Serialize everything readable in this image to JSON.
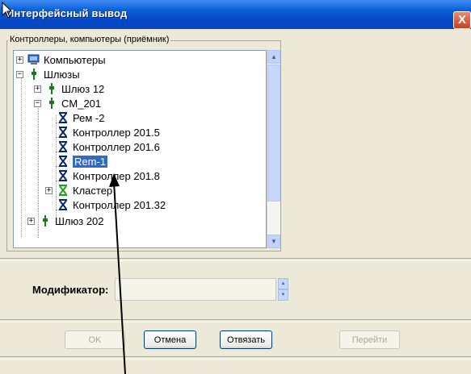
{
  "window": {
    "title": "Интерфейсный вывод",
    "close_glyph": "X"
  },
  "group": {
    "label": "Контроллеры, компьютеры (приёмник)"
  },
  "tree": {
    "items": [
      {
        "label": "Компьютеры",
        "icon": "computer-icon",
        "expander": "+"
      },
      {
        "label": "Шлюзы",
        "icon": "gateway-icon",
        "expander": "−"
      },
      {
        "label": "Шлюз 12",
        "icon": "gateway-icon",
        "expander": "+"
      },
      {
        "label": "CM_201",
        "icon": "gateway-icon",
        "expander": "−"
      },
      {
        "label": "Рем -2",
        "icon": "controller-icon",
        "expander": ""
      },
      {
        "label": "Контроллер 201.5",
        "icon": "controller-icon",
        "expander": ""
      },
      {
        "label": "Контроллер 201.6",
        "icon": "controller-icon",
        "expander": ""
      },
      {
        "label": "Rem-1",
        "icon": "controller-icon",
        "expander": "",
        "selected": true
      },
      {
        "label": "Контроллер 201.8",
        "icon": "controller-icon",
        "expander": ""
      },
      {
        "label": "Кластер",
        "icon": "cluster-icon",
        "expander": "+"
      },
      {
        "label": "Контроллер 201.32",
        "icon": "controller-icon",
        "expander": ""
      },
      {
        "label": "Шлюз 202",
        "icon": "gateway-icon",
        "expander": "+"
      }
    ]
  },
  "modifier": {
    "label": "Модификатор:",
    "value": ""
  },
  "buttons": {
    "ok": "OK",
    "cancel": "Отмена",
    "unbind": "Отвязать",
    "goto": "Перейти"
  },
  "colors": {
    "selection": "#316ac5",
    "titlebar": "#0a5fd8",
    "controller_icon": "#0a246a",
    "cluster_icon": "#1aa01a",
    "gateway_icon": "#1a7a1a"
  }
}
